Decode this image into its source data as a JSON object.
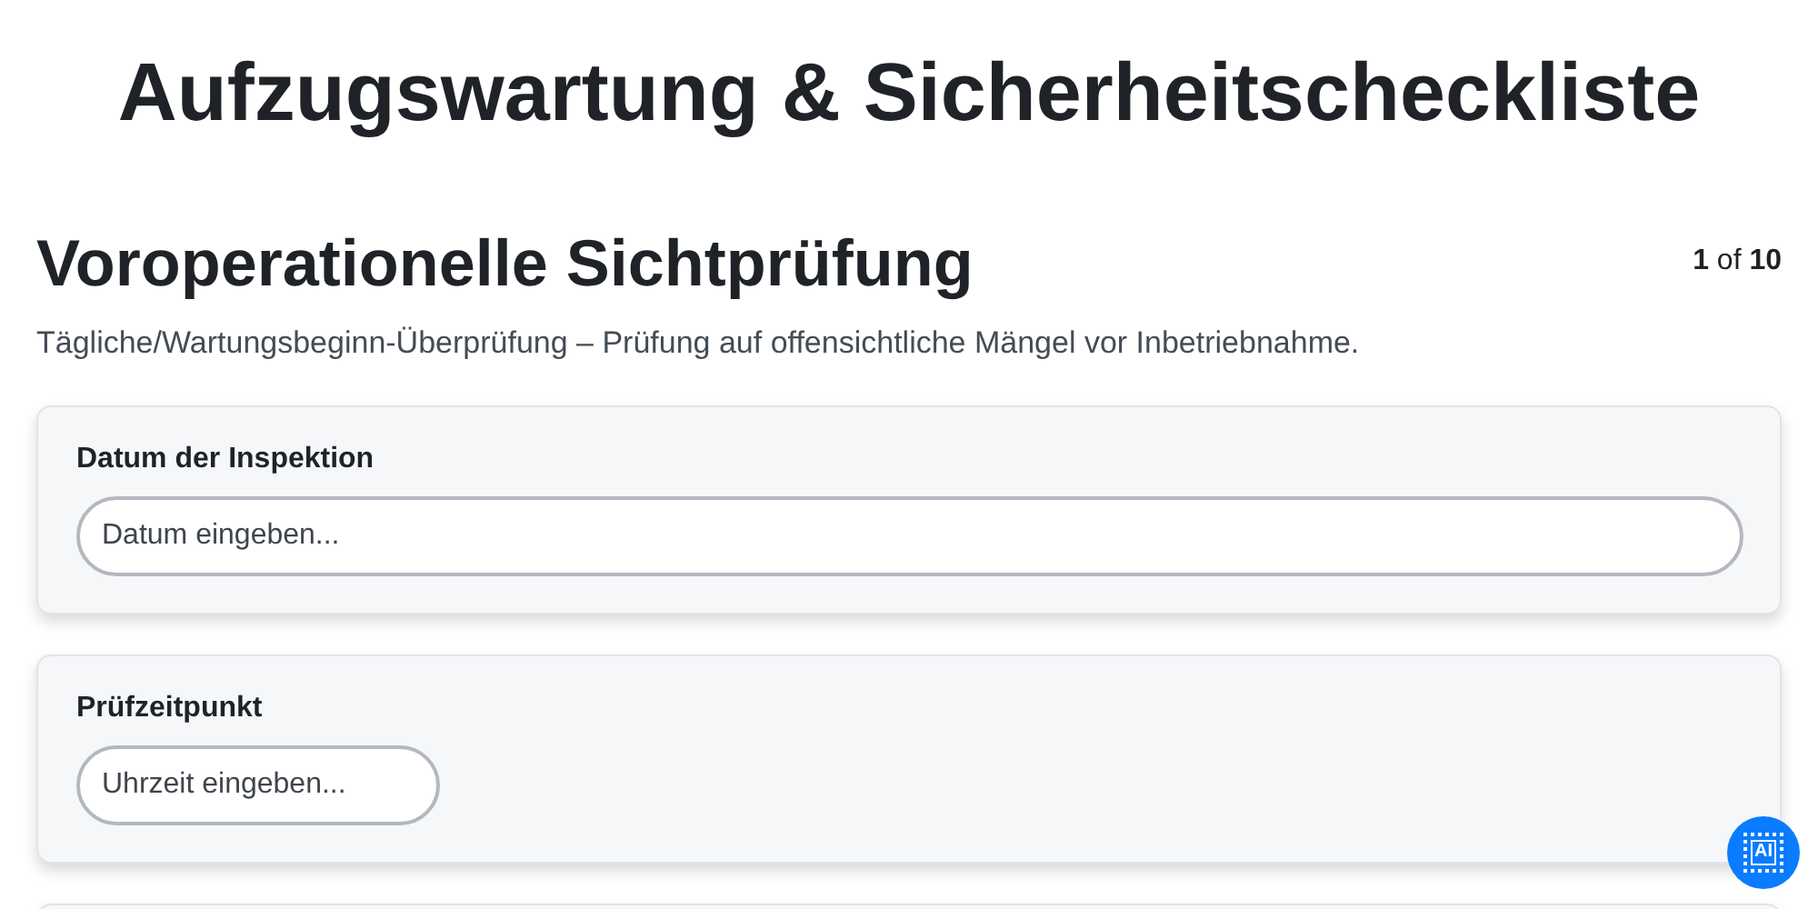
{
  "title": "Aufzugswartung & Sicherheitscheckliste",
  "section": {
    "heading": "Voroperationelle Sichtprüfung",
    "counter": "**1** of **10**",
    "description": "Tägliche/Wartungsbeginn-Überprüfung – Prüfung auf offensichtliche Mängel vor Inbetriebnahme."
  },
  "fields": [
    {
      "kind": "wide",
      "label": "Datum der Inspektion",
      "placeholder": "Datum eingeben..."
    },
    {
      "kind": "narrow",
      "label": "Prüfzeitpunkt",
      "placeholder": "Uhrzeit eingeben..."
    }
  ],
  "ai_button": {
    "label": "AI"
  }
}
